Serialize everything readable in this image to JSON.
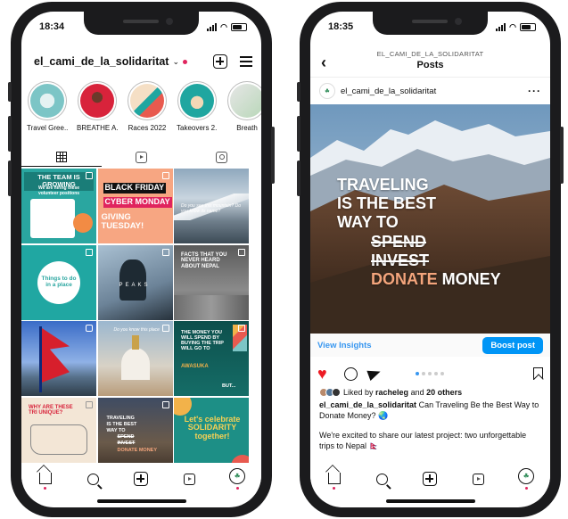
{
  "left": {
    "status": {
      "time": "18:34"
    },
    "profile": {
      "username": "el_cami_de_la_solidaritat"
    },
    "highlights": [
      {
        "label": "Travel Gree...",
        "color": "#7cc5c6"
      },
      {
        "label": "BREATHE A...",
        "color": "#d8233b"
      },
      {
        "label": "Races 2022",
        "color": "#e8c9a8"
      },
      {
        "label": "Takeovers 2...",
        "color": "#1fa6a0"
      },
      {
        "label": "Breath",
        "color": "#e6e6e6"
      }
    ],
    "grid": {
      "p1": {
        "title": "THE TEAM IS GROWING",
        "sub": "We are hiring these volunteer positions"
      },
      "p2": {
        "line1": "BLACK FRIDAY",
        "line2": "CYBER MONDAY",
        "line3": "GIVING TUESDAY!"
      },
      "p3": {
        "text": "Do you see this mountain? Do you know its name?"
      },
      "p4": {
        "text": "Things to do in a place"
      },
      "p5": {
        "text": "PEAKS"
      },
      "p6": {
        "text": "FACTS THAT YOU NEVER HEARD ABOUT NEPAL"
      },
      "p8": {
        "text": "Do you know this place"
      },
      "p9": {
        "text": "THE MONEY YOU WILL SPEND BY BUYING THE TRIP WILL GO TO",
        "highlight": "AWASUKA",
        "tail": "BUT..."
      },
      "p10": {
        "text": "WHY ARE THESE TRI UNIQUE?"
      },
      "p11": {
        "l1": "TRAVELING",
        "l2": "IS THE BEST",
        "l3": "WAY TO",
        "l4": "SPEND",
        "l5": "INVEST",
        "l6": "DONATE MONEY"
      },
      "p12": {
        "text": "Let's celebrate SOLIDARITY together!"
      }
    }
  },
  "right": {
    "status": {
      "time": "18:35"
    },
    "header": {
      "username": "EL_CAMI_DE_LA_SOLIDARITAT",
      "title": "Posts"
    },
    "author": "el_cami_de_la_solidaritat",
    "headline": {
      "l1": "TRAVELING",
      "l2": "IS THE BEST",
      "l3": "WAY TO",
      "l4": "SPEND",
      "l5": "INVEST",
      "l6a": "DONATE",
      "l6b": " MONEY"
    },
    "insights": "View Insights",
    "boost": "Boost post",
    "likes": {
      "prefix": "Liked by ",
      "user": "racheleg",
      "mid": " and ",
      "others": "20 others"
    },
    "caption": {
      "user": "el_cami_de_la_solidaritat",
      "text": " Can Traveling Be the Best Way to Donate Money? 🌏",
      "text2": "We're excited to share our latest project: two unforgettable trips to Nepal 🇳🇵"
    }
  },
  "colors": {
    "accent": "#0095f6",
    "like": "#ed1c24",
    "notification": "#e0245e"
  }
}
